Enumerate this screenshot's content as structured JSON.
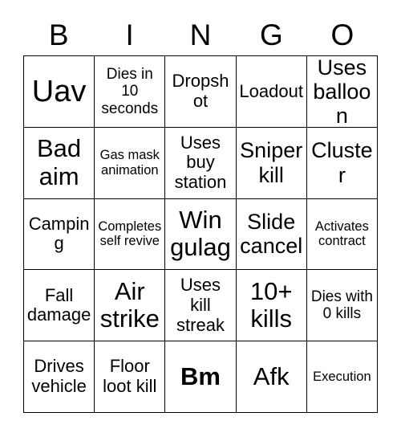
{
  "card": {
    "title": "BINGO",
    "background_color": "#ffffff",
    "text_color": "#000000",
    "border_color": "#000000"
  },
  "header": {
    "letters": [
      "B",
      "I",
      "N",
      "G",
      "O"
    ]
  },
  "grid": {
    "columns": 5,
    "rows": 5,
    "cells": [
      {
        "text": "Uav",
        "size": "fs-xxl",
        "bold": false
      },
      {
        "text": "Dies in 10 seconds",
        "size": "fs-s",
        "bold": false
      },
      {
        "text": "Dropshot",
        "size": "fs-m",
        "bold": false
      },
      {
        "text": "Loadout",
        "size": "fs-m",
        "bold": false
      },
      {
        "text": "Uses balloon",
        "size": "fs-l",
        "bold": false
      },
      {
        "text": "Bad aim",
        "size": "fs-xl",
        "bold": false
      },
      {
        "text": "Gas mask animation",
        "size": "fs-xs",
        "bold": false
      },
      {
        "text": "Uses buy station",
        "size": "fs-m",
        "bold": false
      },
      {
        "text": "Sniper kill",
        "size": "fs-l",
        "bold": false
      },
      {
        "text": "Cluster",
        "size": "fs-l",
        "bold": false
      },
      {
        "text": "Camping",
        "size": "fs-m",
        "bold": false
      },
      {
        "text": "Completes self revive",
        "size": "fs-xs",
        "bold": false
      },
      {
        "text": "Win gulag",
        "size": "fs-xl",
        "bold": false
      },
      {
        "text": "Slide cancel",
        "size": "fs-l",
        "bold": false
      },
      {
        "text": "Activates contract",
        "size": "fs-xs",
        "bold": false
      },
      {
        "text": "Fall damage",
        "size": "fs-m",
        "bold": false
      },
      {
        "text": "Air strike",
        "size": "fs-xl",
        "bold": false
      },
      {
        "text": "Uses kill streak",
        "size": "fs-m",
        "bold": false
      },
      {
        "text": "10+ kills",
        "size": "fs-xl",
        "bold": false
      },
      {
        "text": "Dies with 0 kills",
        "size": "fs-s",
        "bold": false
      },
      {
        "text": "Drives vehicle",
        "size": "fs-m",
        "bold": false
      },
      {
        "text": "Floor loot kill",
        "size": "fs-m",
        "bold": false
      },
      {
        "text": "Bm",
        "size": "fs-xl",
        "bold": true
      },
      {
        "text": "Afk",
        "size": "fs-xl",
        "bold": false
      },
      {
        "text": "Execution",
        "size": "fs-xs",
        "bold": false
      }
    ]
  }
}
